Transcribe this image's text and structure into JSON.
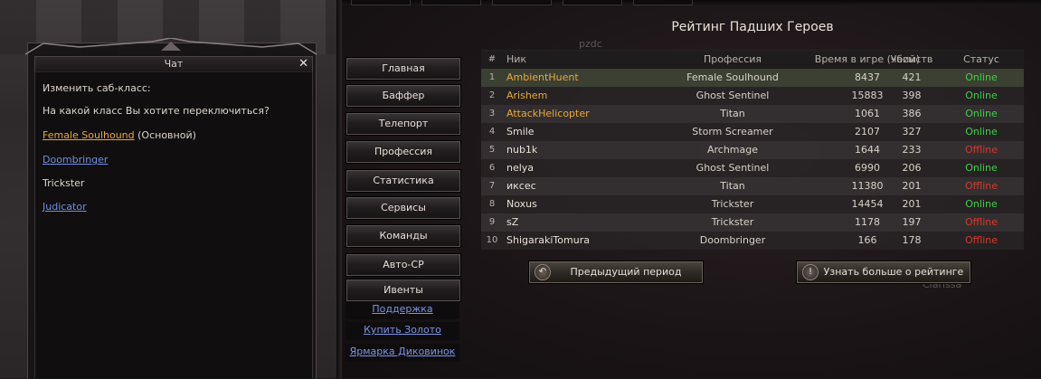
{
  "chat": {
    "title": "Чат",
    "close_label": "✕",
    "prompt_1": "Изменить саб-класс:",
    "prompt_2": "На какой класс Вы хотите переключиться?",
    "options": [
      {
        "label": "Female Soulhound",
        "suffix": " (Основной)"
      },
      {
        "label": "Doombringer"
      },
      {
        "label": "Trickster"
      },
      {
        "label": "Judicator"
      }
    ]
  },
  "menu": {
    "buttons": [
      "Главная",
      "Баффер",
      "Телепорт",
      "Профессия",
      "Статистика",
      "Сервисы",
      "Команды",
      "Авто-CP",
      "Ивенты"
    ],
    "links": [
      "Поддержка",
      "Купить Золото",
      "Ярмарка Диковинок"
    ]
  },
  "rating": {
    "title": "Рейтинг Падших Героев",
    "headers": {
      "num": "#",
      "nick": "Ник",
      "prof": "Профессия",
      "time": "Время в игре (часы)",
      "kills": "Убийств",
      "status": "Статус"
    },
    "rows": [
      {
        "num": "1",
        "nick": "AmbientHuent",
        "prof": "Female Soulhound",
        "time": "8437",
        "kills": "421",
        "status": "Online"
      },
      {
        "num": "2",
        "nick": "Arishem",
        "prof": "Ghost Sentinel",
        "time": "15883",
        "kills": "398",
        "status": "Online"
      },
      {
        "num": "3",
        "nick": "AttackHelicopter",
        "prof": "Titan",
        "time": "1061",
        "kills": "386",
        "status": "Online"
      },
      {
        "num": "4",
        "nick": "Smile",
        "prof": "Storm Screamer",
        "time": "2107",
        "kills": "327",
        "status": "Online"
      },
      {
        "num": "5",
        "nick": "nub1k",
        "prof": "Archmage",
        "time": "1644",
        "kills": "233",
        "status": "Offline"
      },
      {
        "num": "6",
        "nick": "nelya",
        "prof": "Ghost Sentinel",
        "time": "6990",
        "kills": "206",
        "status": "Online"
      },
      {
        "num": "7",
        "nick": "иксес",
        "prof": "Titan",
        "time": "11380",
        "kills": "201",
        "status": "Offline"
      },
      {
        "num": "8",
        "nick": "Noxus",
        "prof": "Trickster",
        "time": "14454",
        "kills": "201",
        "status": "Online"
      },
      {
        "num": "9",
        "nick": "sZ",
        "prof": "Trickster",
        "time": "1178",
        "kills": "197",
        "status": "Offline"
      },
      {
        "num": "10",
        "nick": "ShigarakiTomura",
        "prof": "Doombringer",
        "time": "166",
        "kills": "178",
        "status": "Offline"
      }
    ],
    "prev_button": "Предыдущий период",
    "info_button": "Узнать больше о рейтинге"
  },
  "background": {
    "overlay_1": "pzdc",
    "overlay_2": "Clarissa"
  },
  "colors": {
    "online": "#3fcf46",
    "offline": "#d43a2e",
    "top_nick": "#e8a83a",
    "link": "#6f8fe0"
  }
}
